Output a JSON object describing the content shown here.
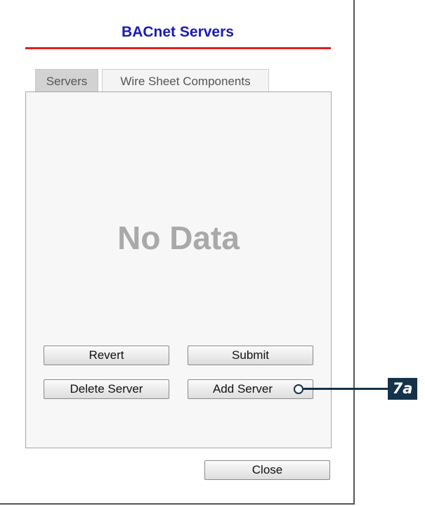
{
  "dialog": {
    "title": "BACnet Servers"
  },
  "tabs": [
    {
      "label": "Servers",
      "active": true
    },
    {
      "label": "Wire Sheet Components",
      "active": false
    }
  ],
  "panel": {
    "empty_message": "No Data"
  },
  "buttons": {
    "revert": "Revert",
    "submit": "Submit",
    "delete_server": "Delete Server",
    "add_server": "Add Server",
    "close": "Close"
  },
  "callout": {
    "label": "7a"
  },
  "colors": {
    "title": "#1a1ab8",
    "title_rule": "#e11e1e",
    "callout": "#15324d",
    "empty_text": "#a9a9a9"
  }
}
